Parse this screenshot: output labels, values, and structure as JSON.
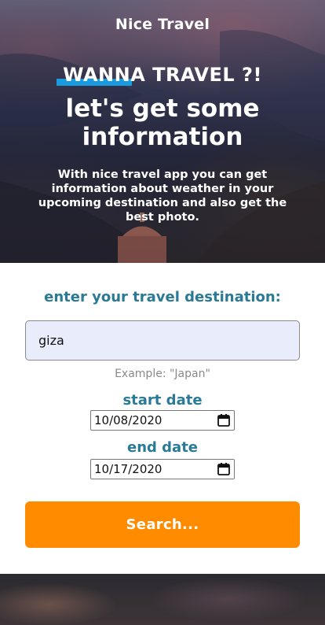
{
  "header": {
    "brand": "Nice Travel",
    "headline": "WANNA TRAVEL ?!",
    "subheadline": "let's get some information",
    "description": "With nice travel app you can get information about weather in your upcoming destination and also get the best photo."
  },
  "form": {
    "title": "enter your travel destination:",
    "destination_value": "giza",
    "example_hint": "Example: \"Japan\"",
    "start_label": "start date",
    "start_value": "10/08/2020",
    "end_label": "end date",
    "end_value": "10/17/2020",
    "search_label": "Search..."
  },
  "colors": {
    "accent_bar": "#1a9be0",
    "label_teal": "#2a7a96",
    "button_orange": "#ff8c00",
    "input_bg": "#e9ecfb"
  },
  "icons": {
    "date_picker": "calendar-icon"
  }
}
